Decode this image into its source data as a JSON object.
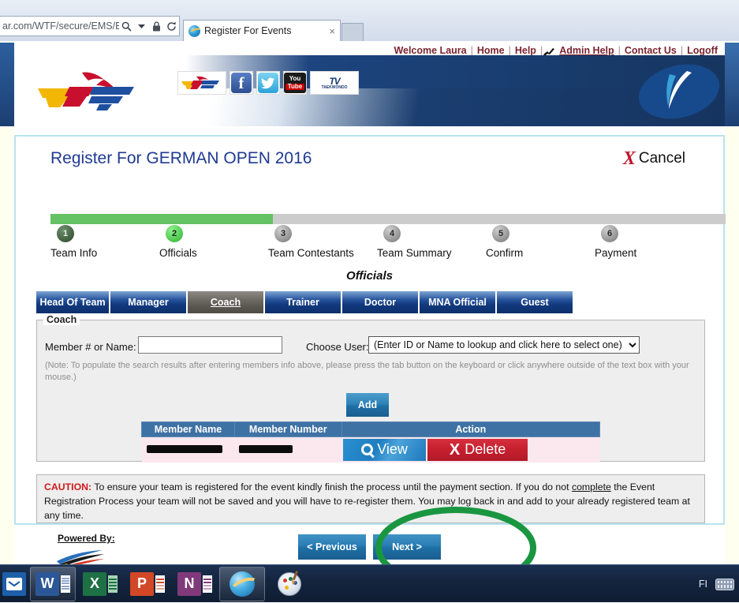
{
  "browser": {
    "address_text": "ar.com/WTF/secure/EMS/EMS",
    "search_icon": "search-icon",
    "dropdown_icon": "chevron-down-icon",
    "lock_icon": "lock-icon",
    "refresh_icon": "refresh-icon",
    "tab_title": "Register For Events",
    "tab_close": "×",
    "tab_favicon": "internet-explorer-icon"
  },
  "utility_nav": {
    "welcome": "Welcome Laura",
    "sep": "|",
    "items": [
      {
        "label": "Home",
        "underlined": false
      },
      {
        "label": "Help",
        "underlined": false
      },
      {
        "label": "Admin Help",
        "underlined": true
      },
      {
        "label": "Contact Us",
        "underlined": false
      },
      {
        "label": "Logoff",
        "underlined": false
      }
    ],
    "kick_icon": "taekwondo-kick-icon"
  },
  "banner": {
    "logo": "wtf-logo",
    "social": [
      {
        "name": "wtf-site-icon",
        "label": "WTF"
      },
      {
        "name": "facebook-icon",
        "label": "f"
      },
      {
        "name": "twitter-icon",
        "label": "t"
      },
      {
        "name": "youtube-icon",
        "label_top": "You",
        "label_bottom": "Tube"
      },
      {
        "name": "wtf-tv-icon",
        "label_top": "TV",
        "label_bottom": "TAEKWONDO"
      }
    ],
    "right_logo": "blue-oval-logo"
  },
  "form": {
    "title": "Register For GERMAN OPEN 2016",
    "cancel_label": "Cancel",
    "cancel_icon": "red-x-icon",
    "progress_percent": 33,
    "steps": [
      {
        "number": "1",
        "label": "Team Info",
        "state": "done"
      },
      {
        "number": "2",
        "label": "Officials",
        "state": "active"
      },
      {
        "number": "3",
        "label": "Team Contestants",
        "state": "todo"
      },
      {
        "number": "4",
        "label": "Team Summary",
        "state": "todo"
      },
      {
        "number": "5",
        "label": "Confirm",
        "state": "todo"
      },
      {
        "number": "6",
        "label": "Payment",
        "state": "todo"
      }
    ],
    "section_title": "Officials",
    "tabs": [
      {
        "label": "Head Of Team",
        "active": false
      },
      {
        "label": "Manager",
        "active": false
      },
      {
        "label": "Coach",
        "active": true
      },
      {
        "label": "Trainer",
        "active": false
      },
      {
        "label": "Doctor",
        "active": false
      },
      {
        "label": "MNA Official",
        "active": false
      },
      {
        "label": "Guest",
        "active": false
      }
    ],
    "fieldset_legend": "Coach",
    "member_label": "Member # or Name:",
    "member_value": "",
    "member_placeholder": "",
    "choose_user_label": "Choose User:",
    "choose_user_selected": "(Enter ID or Name to lookup and click here to select one)",
    "note": "(Note: To populate the search results after entering members info above, please press the tab button on the keyboard or click anywhere outside of the text box with your mouse.)",
    "add_label": "Add",
    "table": {
      "headers": [
        "Member Name",
        "Member Number",
        "Action"
      ],
      "rows": [
        {
          "member_name": "[REDACTED]",
          "member_number": "[REDACTED]",
          "view_label": "View",
          "delete_label": "Delete"
        }
      ]
    },
    "caution": {
      "prefix": "CAUTION:",
      "body_1": " To ensure your team is registered for the event kindly finish the process until the payment section. If you do not ",
      "underlined_1": "complete",
      "body_2": " the Event Registration Process your team will not be saved and you will have to re-register them. You may log back in and add to your already registered team at any time."
    },
    "previous_label": "< Previous",
    "next_label": "Next >"
  },
  "footer": {
    "powered_by": "Powered By:",
    "logo": "swoosh-logo"
  },
  "annotation": {
    "shape": "green-ellipse-highlight",
    "color": "#1a9641"
  },
  "taskbar": {
    "items": [
      {
        "name": "taskbar-outlook",
        "label": "O"
      },
      {
        "name": "taskbar-word",
        "label": "W"
      },
      {
        "name": "taskbar-excel",
        "label": "X"
      },
      {
        "name": "taskbar-powerpoint",
        "label": "P"
      },
      {
        "name": "taskbar-onenote",
        "label": "N"
      },
      {
        "name": "taskbar-internet-explorer",
        "label": ""
      },
      {
        "name": "taskbar-paint",
        "label": ""
      }
    ],
    "tray_language": "FI",
    "tray_keyboard_icon": "keyboard-icon"
  }
}
